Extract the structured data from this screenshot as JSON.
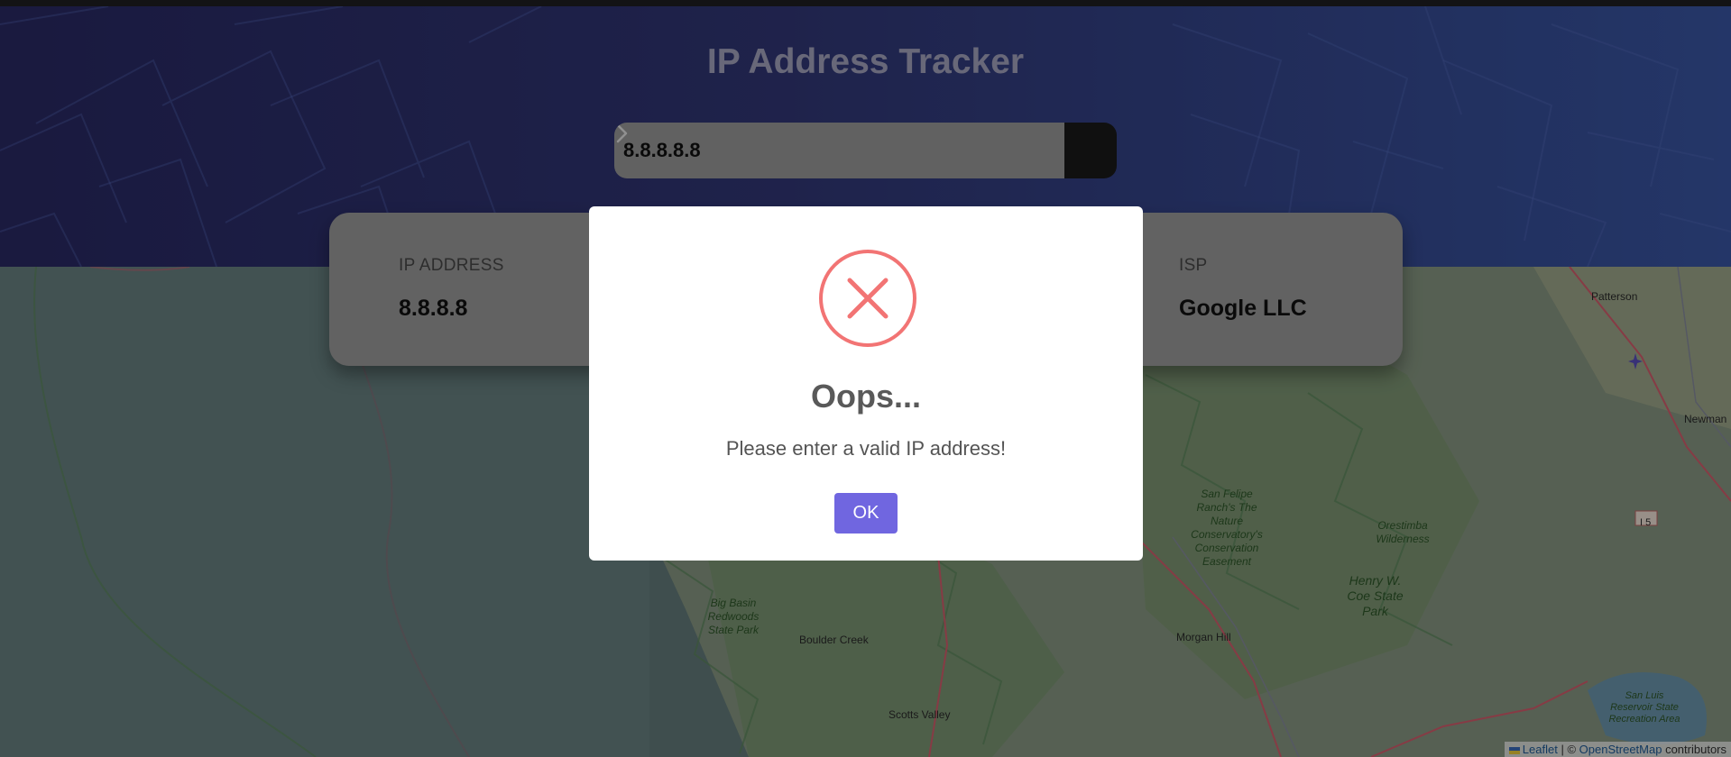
{
  "header": {
    "title": "IP Address Tracker"
  },
  "search": {
    "value": "8.8.8.8.8",
    "submit_icon": "chevron-right-icon"
  },
  "info": {
    "ip_label": "IP ADDRESS",
    "ip_value": "8.8.8.8",
    "isp_label": "ISP",
    "isp_value": "Google LLC"
  },
  "map": {
    "labels": {
      "patterson": "Patterson",
      "newman": "Newman",
      "i5": "I 5",
      "san_felipe": "San Felipe Ranch's The Nature Conservatory's Conservation Easement",
      "orestimba": "Orestimba Wilderness",
      "henry_coe": "Henry W. Coe State Park",
      "morgan_hill": "Morgan Hill",
      "big_basin": "Big Basin Redwoods State Park",
      "boulder_creek": "Boulder Creek",
      "scotts_valley": "Scotts Valley",
      "san_luis": "San Luis Reservoir State Recreation Area"
    },
    "attribution": {
      "leaflet": "Leaflet",
      "separator": "| ©",
      "osm": "OpenStreetMap",
      "contributors": "contributors"
    }
  },
  "dialog": {
    "icon": "error-x-icon",
    "title": "Oops...",
    "message": "Please enter a valid IP address!",
    "ok_label": "OK"
  },
  "colors": {
    "accent": "#7066e0",
    "error": "#f27474",
    "hero_start": "#2a2a66",
    "hero_end": "#3a58a8"
  }
}
